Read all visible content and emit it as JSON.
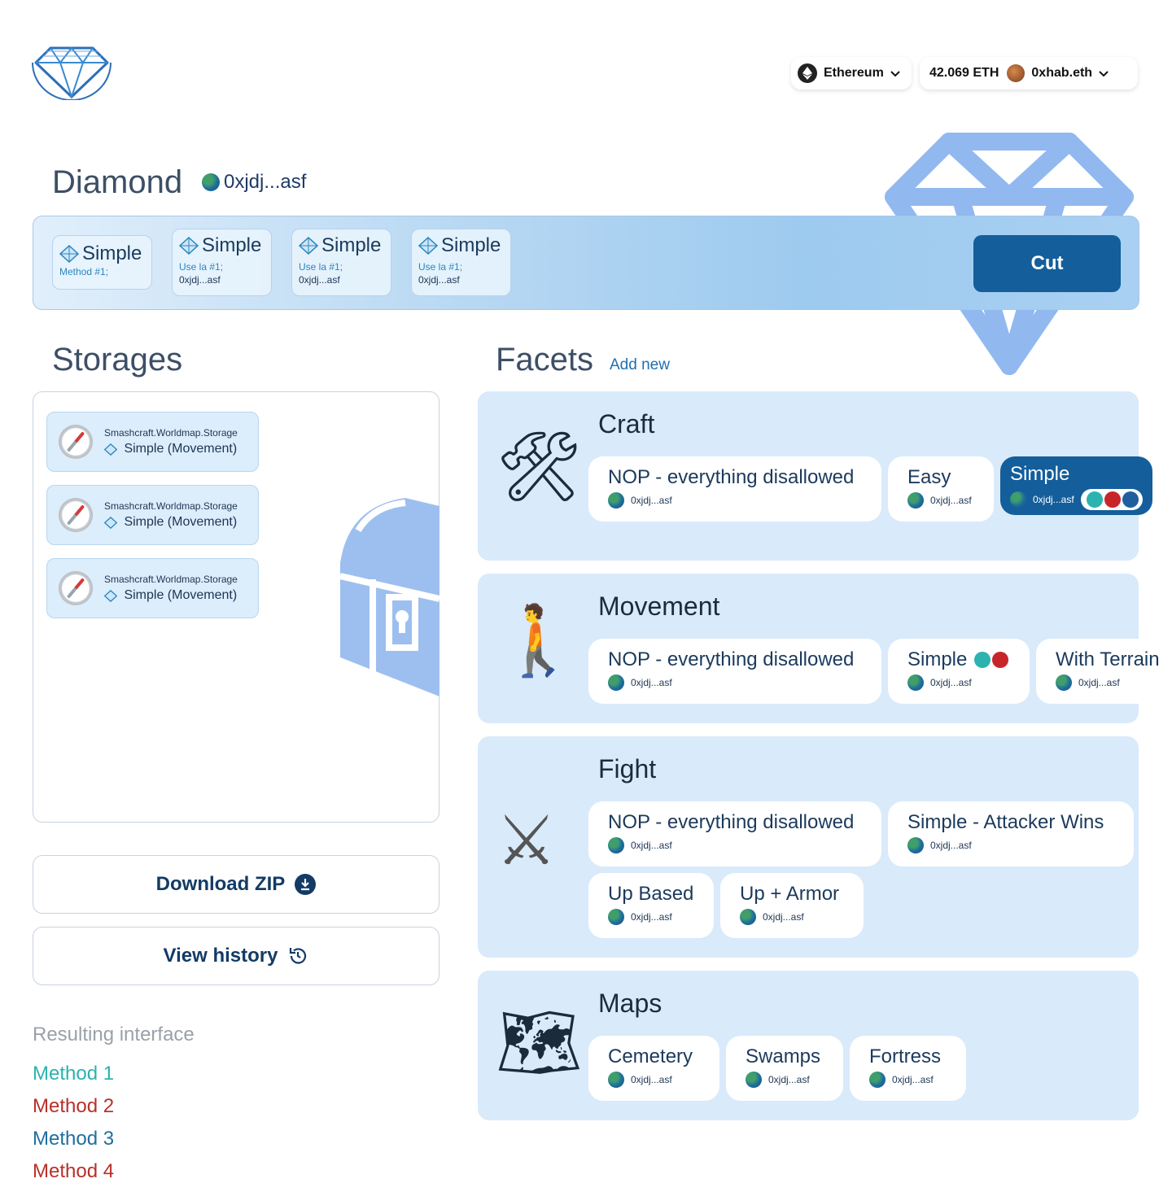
{
  "header": {
    "network": "Ethereum",
    "balance": "42.069 ETH",
    "account": "0xhab.eth"
  },
  "diamond": {
    "title": "Diamond",
    "address": "0xjdj...asf",
    "cut_cards": [
      {
        "name": "Simple",
        "line1": "Method #1;",
        "line2": ""
      },
      {
        "name": "Simple",
        "line1": "Use la #1;",
        "line2": "0xjdj...asf"
      },
      {
        "name": "Simple",
        "line1": "Use la #1;",
        "line2": "0xjdj...asf"
      },
      {
        "name": "Simple",
        "line1": "Use la #1;",
        "line2": "0xjdj...asf"
      }
    ],
    "cut_label": "Cut"
  },
  "storages": {
    "title": "Storages",
    "items": [
      {
        "storage": "Smashcraft.Worldmap.Storage",
        "facet": "Simple (Movement)"
      },
      {
        "storage": "Smashcraft.Worldmap.Storage",
        "facet": "Simple (Movement)"
      },
      {
        "storage": "Smashcraft.Worldmap.Storage",
        "facet": "Simple (Movement)"
      }
    ],
    "download_label": "Download ZIP",
    "history_label": "View history"
  },
  "resulting": {
    "title": "Resulting interface",
    "methods": [
      {
        "label": "Method 1",
        "color": "#2bb3b0"
      },
      {
        "label": "Method 2",
        "color": "#b8302a"
      },
      {
        "label": "Method 3",
        "color": "#1f6f9e"
      },
      {
        "label": "Method 4",
        "color": "#b8302a"
      }
    ]
  },
  "facets": {
    "title": "Facets",
    "add_new": "Add new",
    "groups": [
      {
        "name": "Craft",
        "icon": "hammer-and-wrench-icon",
        "emoji": "🛠",
        "cards": [
          {
            "name": "NOP - everything disallowed",
            "addr": "0xjdj...asf"
          },
          {
            "name": "Easy",
            "addr": "0xjdj...asf"
          },
          {
            "name": "Simple",
            "addr": "0xjdj...asf",
            "selected": true
          }
        ]
      },
      {
        "name": "Movement",
        "icon": "person-walking-icon",
        "emoji": "🚶",
        "cards": [
          {
            "name": "NOP - everything disallowed",
            "addr": "0xjdj...asf"
          },
          {
            "name": "Simple",
            "addr": "0xjdj...asf"
          },
          {
            "name": "With Terrain",
            "addr": "0xjdj...asf"
          }
        ]
      },
      {
        "name": "Fight",
        "icon": "crossed-swords-icon",
        "emoji": "⚔",
        "cards": [
          {
            "name": "NOP - everything disallowed",
            "addr": "0xjdj...asf"
          },
          {
            "name": "Simple - Attacker Wins",
            "addr": "0xjdj...asf"
          },
          {
            "name": "Up Based",
            "addr": "0xjdj...asf"
          },
          {
            "name": "Up + Armor",
            "addr": "0xjdj...asf"
          }
        ]
      },
      {
        "name": "Maps",
        "icon": "world-map-icon",
        "emoji": "🗺",
        "cards": [
          {
            "name": "Cemetery",
            "addr": "0xjdj...asf"
          },
          {
            "name": "Swamps",
            "addr": "0xjdj...asf"
          },
          {
            "name": "Fortress",
            "addr": "0xjdj...asf"
          }
        ]
      }
    ]
  },
  "colors": {
    "accent": "#135e9b",
    "teal": "#2bb3b0",
    "red": "#c8252a",
    "navy": "#1f5f9e",
    "facet_bg": "#d9eafa"
  }
}
